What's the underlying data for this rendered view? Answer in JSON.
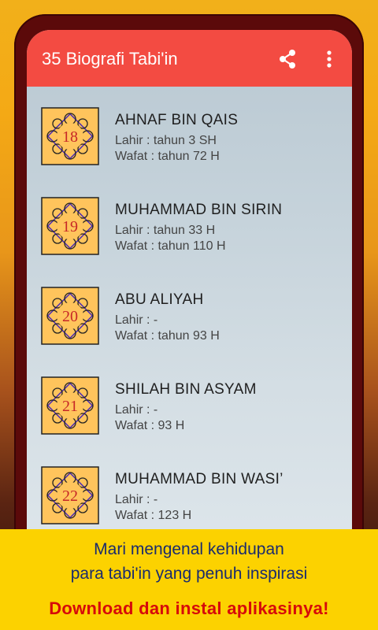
{
  "app": {
    "title": "35 Biografi Tabi'in",
    "share_icon": "share-icon",
    "menu_icon": "more-vert-icon",
    "accent_color": "#f34b42"
  },
  "list": [
    {
      "number": "18",
      "name": "AHNAF BIN QAIS",
      "lahir": "Lahir : tahun 3 SH",
      "wafat": "Wafat :  tahun 72 H"
    },
    {
      "number": "19",
      "name": "MUHAMMAD BIN SIRIN",
      "lahir": "Lahir : tahun 33 H",
      "wafat": "Wafat : tahun 110 H"
    },
    {
      "number": "20",
      "name": "ABU ALIYAH",
      "lahir": "Lahir : -",
      "wafat": "Wafat : tahun 93 H"
    },
    {
      "number": "21",
      "name": "SHILAH BIN ASYAM",
      "lahir": "Lahir : -",
      "wafat": "Wafat : 93 H"
    },
    {
      "number": "22",
      "name": "MUHAMMAD BIN WASI’",
      "lahir": "Lahir : -",
      "wafat": "Wafat : 123 H"
    }
  ],
  "banner": {
    "line1": "Mari mengenal kehidupan",
    "line2": "para tabi'in yang penuh inspirasi",
    "cta": "Download dan instal aplikasinya!",
    "background_color": "#fcd200"
  }
}
